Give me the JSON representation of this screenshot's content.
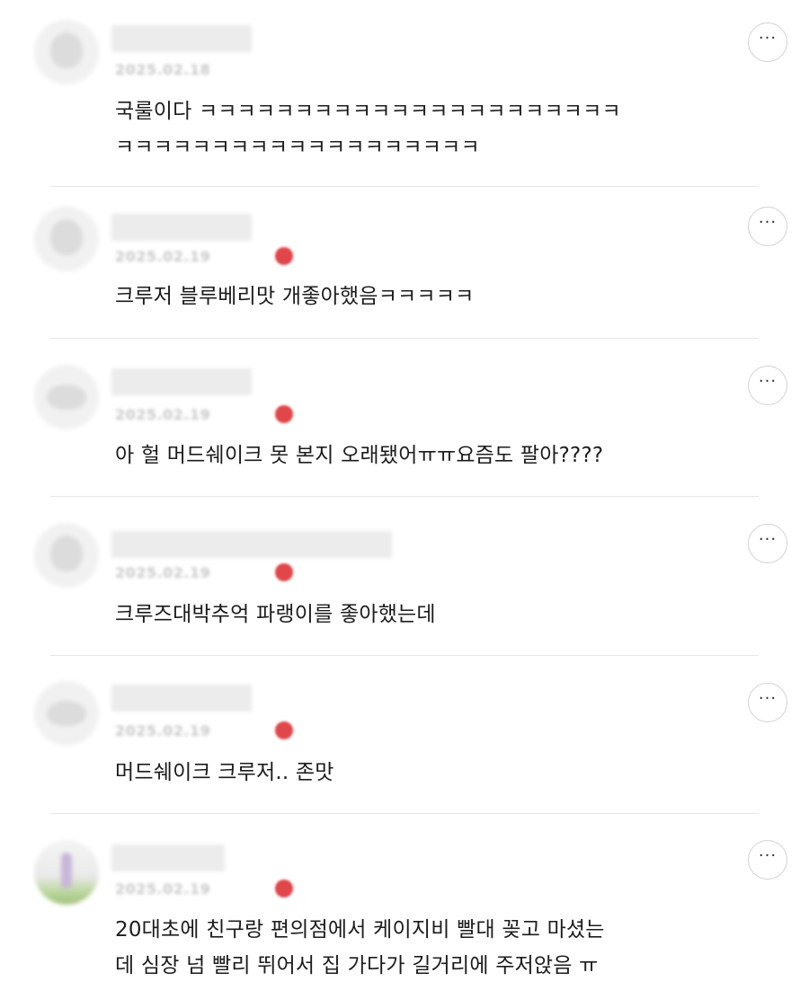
{
  "comments": [
    {
      "date": "2025.02.18",
      "has_badge": false,
      "text": "국룰이다 ㅋㅋㅋㅋㅋㅋㅋㅋㅋㅋㅋㅋㅋㅋㅋㅋㅋㅋㅋㅋㅋㅋ\nㅋㅋㅋㅋㅋㅋㅋㅋㅋㅋㅋㅋㅋㅋㅋㅋㅋㅋㅋ",
      "more_label": "···"
    },
    {
      "date": "2025.02.19",
      "has_badge": true,
      "text": "크루저 블루베리맛 개좋아했음ㅋㅋㅋㅋㅋ",
      "more_label": "···"
    },
    {
      "date": "2025.02.19",
      "has_badge": true,
      "text": "아 헐 머드쉐이크 못 본지 오래됐어ㅠㅠ요즘도 팔아????",
      "more_label": "···"
    },
    {
      "date": "2025.02.19",
      "has_badge": true,
      "text": "크루즈대박추억 파랭이를 좋아했는데",
      "more_label": "···"
    },
    {
      "date": "2025.02.19",
      "has_badge": true,
      "text": "머드쉐이크 크루저.. 존맛",
      "more_label": "···"
    },
    {
      "date": "2025.02.19",
      "has_badge": true,
      "text": "20대초에 친구랑 편의점에서 케이지비 빨대 꽂고 마셨는\n데 심장 넘 빨리 뛰어서 집 가다가 길거리에 주저앉음 ㅠ",
      "more_label": "···"
    }
  ],
  "icons": {
    "avatar_1": "penguin-avatar-icon",
    "avatar_2": "bunny-avatar-icon",
    "avatar_3": "animal-avatar-icon",
    "avatar_4": "cat-avatar-icon",
    "avatar_5": "animal-avatar-icon",
    "avatar_6": "photo-avatar",
    "more": "more-options-icon"
  },
  "colors": {
    "badge": "#e0464a",
    "divider": "#e6e6e6"
  }
}
